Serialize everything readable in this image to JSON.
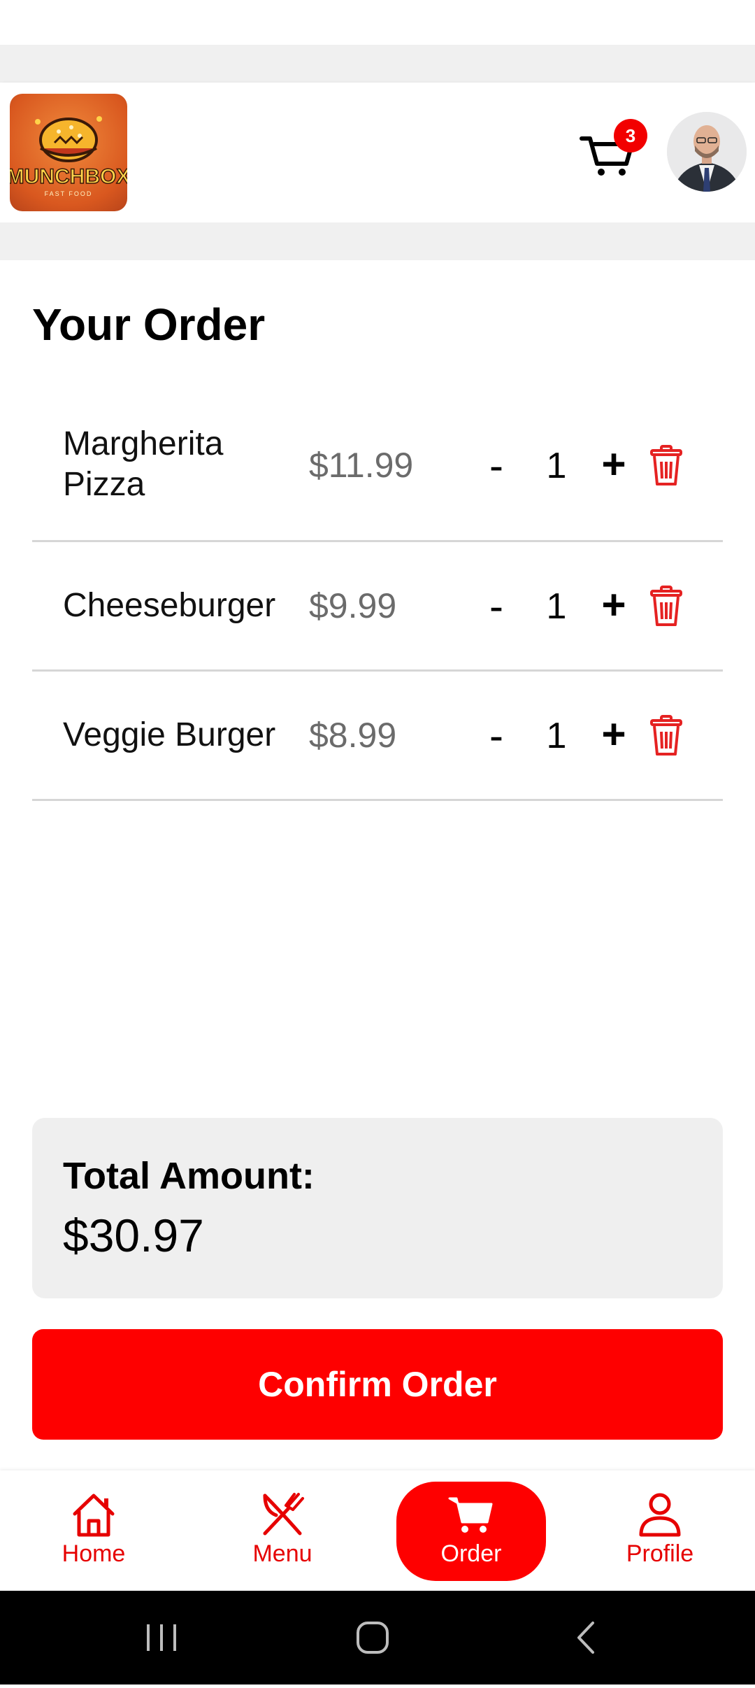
{
  "header": {
    "logo_text": "MUNCHBOX",
    "logo_subtext": "FAST FOOD",
    "cart_badge": "3"
  },
  "page": {
    "title": "Your Order"
  },
  "order_items": [
    {
      "name_line1": "Margherita",
      "name_line2": "Pizza",
      "price": "$11.99",
      "qty": "1",
      "minus": "-",
      "plus": "+"
    },
    {
      "name": "Cheeseburger",
      "price": "$9.99",
      "qty": "1",
      "minus": "-",
      "plus": "+"
    },
    {
      "name": "Veggie Burger",
      "price": "$8.99",
      "qty": "1",
      "minus": "-",
      "plus": "+"
    }
  ],
  "total": {
    "label": "Total Amount:",
    "value": "$30.97"
  },
  "confirm_label": "Confirm Order",
  "nav": {
    "home": "Home",
    "menu": "Menu",
    "order": "Order",
    "profile": "Profile"
  },
  "icons": {
    "cart": "cart-icon",
    "trash": "trash-icon",
    "home": "home-icon",
    "menu": "fork-knife-icon",
    "order": "cart-icon",
    "profile": "person-icon",
    "recents": "recents-icon",
    "home_system": "home-circle-icon",
    "back": "back-chevron-icon"
  },
  "colors": {
    "accent": "#fe0000",
    "badge": "#f20000",
    "price_gray": "#6b6b6b",
    "total_bg": "#efefef"
  }
}
